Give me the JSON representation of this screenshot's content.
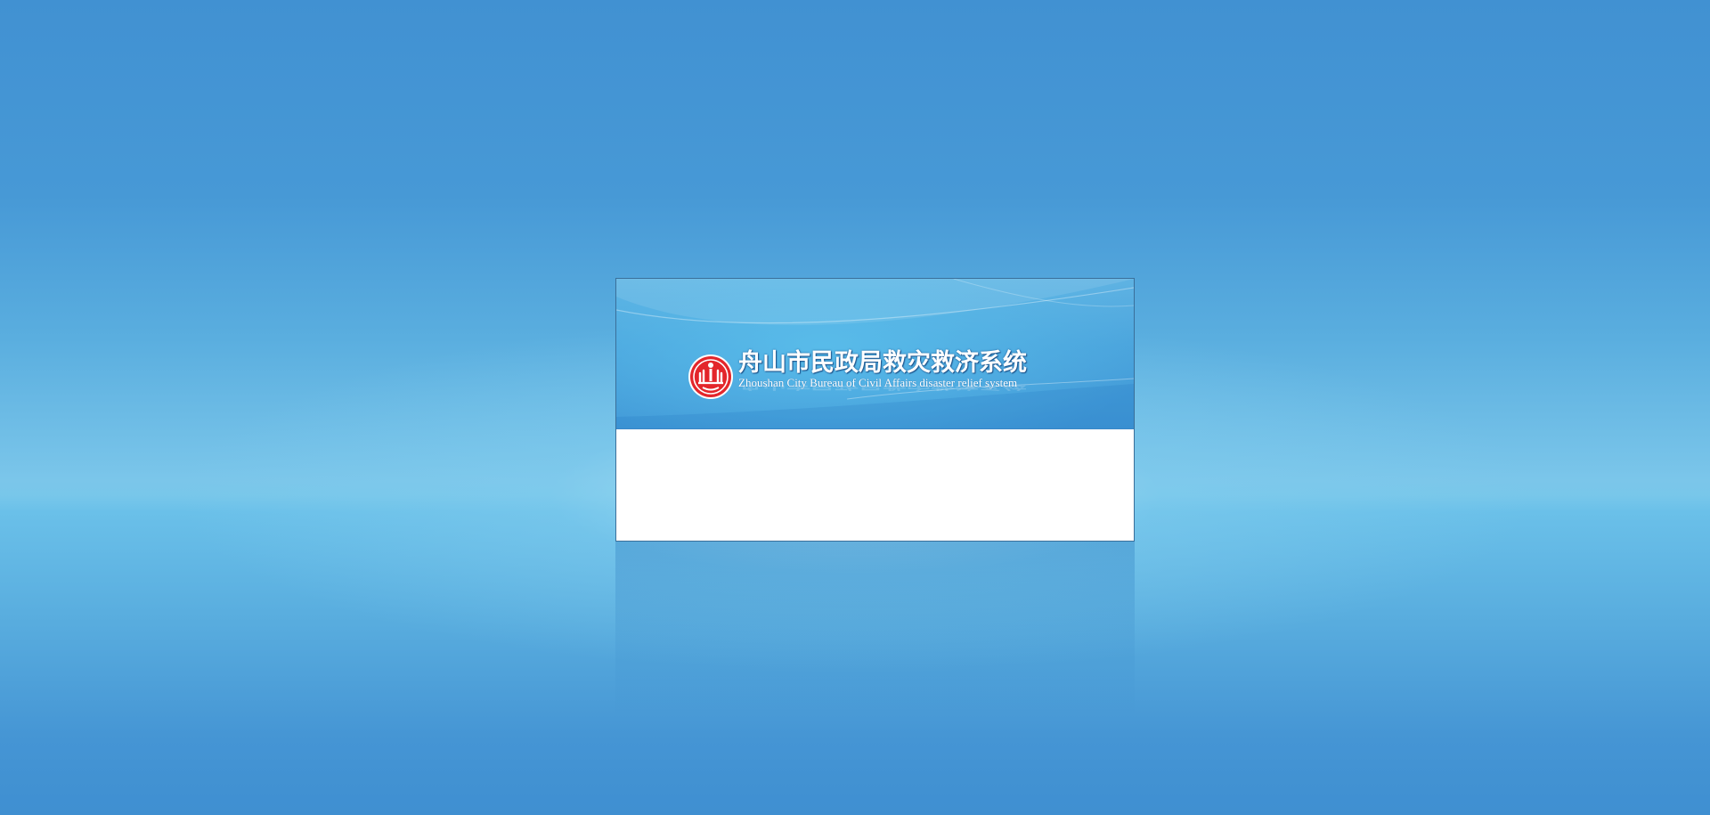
{
  "app": {
    "title_cn": "舟山市民政局救灾救济系统",
    "title_en": "Zhoushan City Bureau of Civil Affairs disaster relief system"
  },
  "emblem": {
    "icon": "civil-affairs-emblem-icon",
    "color": "#e3262b"
  },
  "colors": {
    "background": "#4191d2",
    "banner": "#4aa3dc",
    "panel_border": "#3a6f9a"
  }
}
